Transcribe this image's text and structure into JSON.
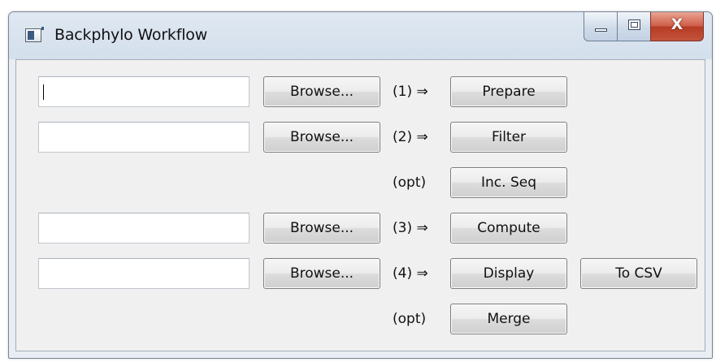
{
  "window": {
    "title": "Backphylo Workflow",
    "controls": {
      "minimize_icon": "minimize-icon",
      "maximize_icon": "maximize-icon",
      "close_glyph": "X"
    }
  },
  "rows": [
    {
      "input_value": "",
      "browse_label": "Browse...",
      "step_label": "(1) ⇒",
      "action_label": "Prepare"
    },
    {
      "input_value": "",
      "browse_label": "Browse...",
      "step_label": "(2) ⇒",
      "action_label": "Filter"
    },
    {
      "step_label": "(opt)",
      "action_label": "Inc. Seq"
    },
    {
      "input_value": "",
      "browse_label": "Browse...",
      "step_label": "(3) ⇒",
      "action_label": "Compute"
    },
    {
      "input_value": "",
      "browse_label": "Browse...",
      "step_label": "(4) ⇒",
      "action_label": "Display",
      "extra_label": "To CSV"
    },
    {
      "step_label": "(opt)",
      "action_label": "Merge"
    }
  ],
  "colors": {
    "window_frame": "#d3dfec",
    "client_bg": "#f0f0f0",
    "close_button": "#c4533c"
  }
}
